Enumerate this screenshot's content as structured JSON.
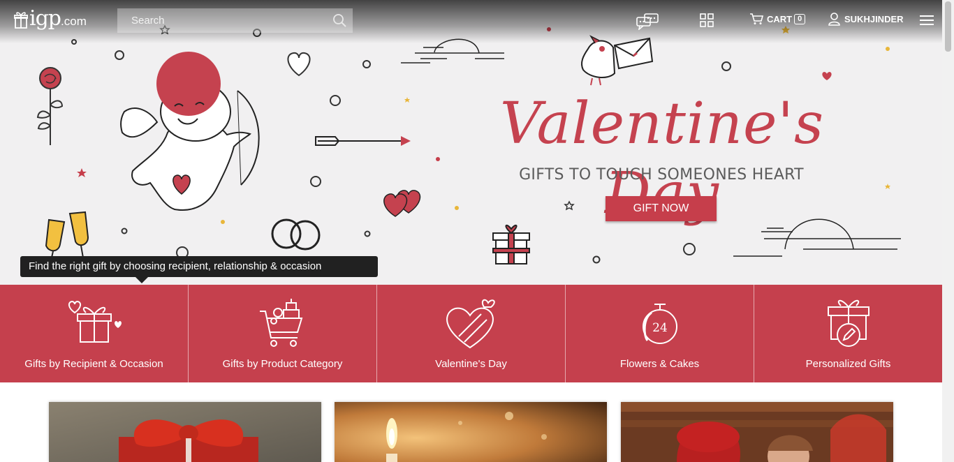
{
  "header": {
    "logo_main": "igp",
    "logo_suffix": ".com",
    "search_placeholder": "Search",
    "cart_label": "CART",
    "cart_count": "0",
    "user_name": "SUKHJINDER",
    "icons": [
      "chat-icon",
      "grid-icon",
      "cart-icon",
      "user-icon",
      "menu-icon",
      "search-icon"
    ]
  },
  "hero": {
    "title": "Valentine's Day",
    "subtitle": "GIFTS TO TOUCH SOMEONES HEART",
    "cta_label": "GIFT NOW",
    "colors": {
      "accent": "#c5424f",
      "background": "#f1f0f1",
      "text": "#5b5b5b"
    }
  },
  "tooltip": {
    "text": "Find the right gift by choosing recipient, relationship & occasion"
  },
  "categories": {
    "background": "#c5404d",
    "items": [
      {
        "label": "Gifts by Recipient & Occasion",
        "icon": "gift-hearts-icon"
      },
      {
        "label": "Gifts by Product Category",
        "icon": "shopping-cart-icon"
      },
      {
        "label": "Valentine's Day",
        "icon": "heart-box-icon"
      },
      {
        "label": "Flowers & Cakes",
        "icon": "stopwatch-24-icon"
      },
      {
        "label": "Personalized Gifts",
        "icon": "gift-pen-icon"
      }
    ],
    "badge_24": "24"
  },
  "cards": [
    {
      "name": "red-ribbon-gift"
    },
    {
      "name": "candle-light"
    },
    {
      "name": "couple-photo"
    }
  ]
}
